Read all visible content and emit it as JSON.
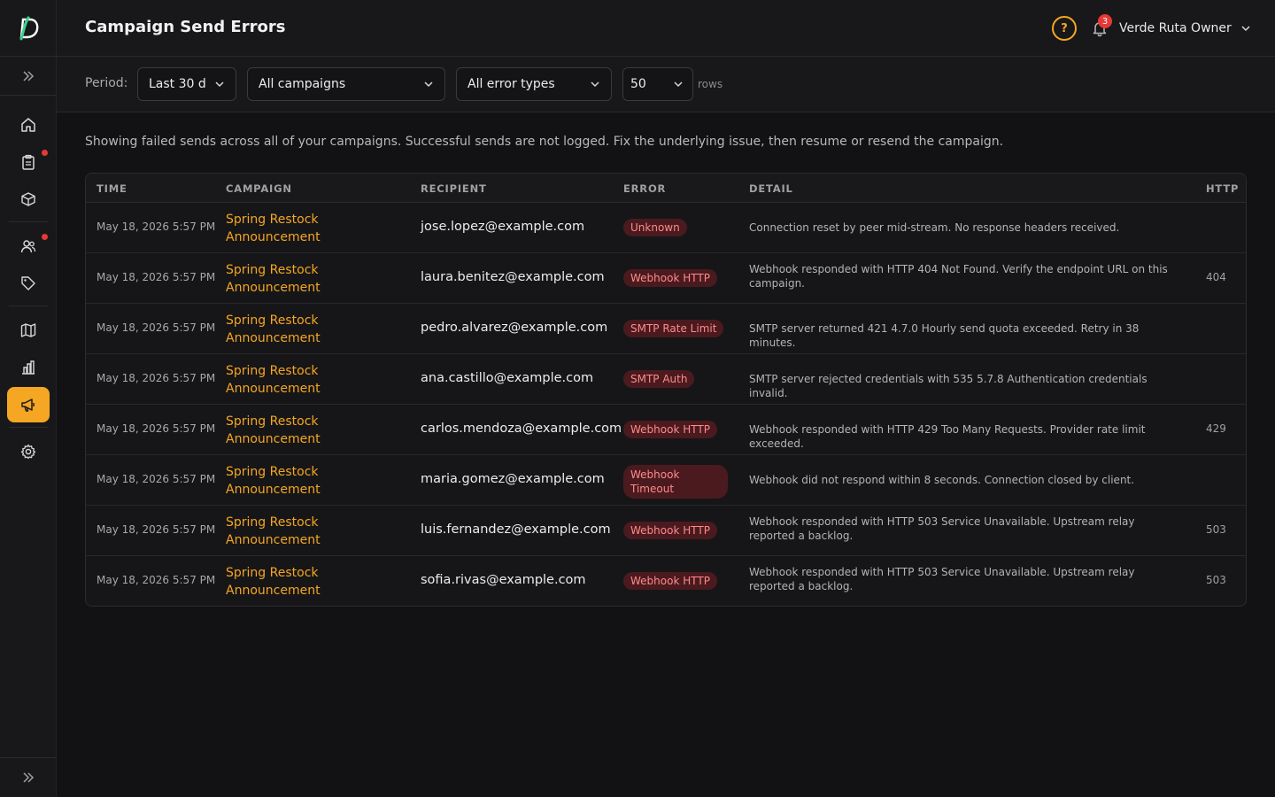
{
  "header": {
    "title": "Campaign Send Errors",
    "help_icon": "question-circle-icon",
    "notifications_count": "3",
    "user_name": "Verde Ruta Owner"
  },
  "filters": {
    "period_label": "Period:",
    "period_value": "Last 30 d",
    "campaign_value": "All campaigns",
    "error_type_value": "All error types",
    "rows_value": "50",
    "rows_label": "rows"
  },
  "description": "Showing failed sends across all of your campaigns. Successful sends are not logged. Fix the underlying issue, then resume or resend the campaign.",
  "table": {
    "columns": [
      "TIME",
      "CAMPAIGN",
      "RECIPIENT",
      "ERROR",
      "DETAIL",
      "HTTP"
    ],
    "rows": [
      {
        "time": "May 18, 2026 5:57 PM",
        "campaign_l1": "Spring Restock",
        "campaign_l2": "Announcement",
        "recipient": "jose.lopez@example.com",
        "error": "Unknown",
        "detail": "Connection reset by peer mid-stream. No response headers received.",
        "http": ""
      },
      {
        "time": "May 18, 2026 5:57 PM",
        "campaign_l1": "Spring Restock",
        "campaign_l2": "Announcement",
        "recipient": "laura.benitez@example.com",
        "error": "Webhook HTTP",
        "detail": "Webhook responded with HTTP 404 Not Found. Verify the endpoint URL on this campaign.",
        "http": "404"
      },
      {
        "time": "May 18, 2026 5:57 PM",
        "campaign_l1": "Spring Restock",
        "campaign_l2": "Announcement",
        "recipient": "pedro.alvarez@example.com",
        "error": "SMTP Rate Limit",
        "detail": "SMTP server returned 421 4.7.0 Hourly send quota exceeded. Retry in 38 minutes.",
        "http": ""
      },
      {
        "time": "May 18, 2026 5:57 PM",
        "campaign_l1": "Spring Restock",
        "campaign_l2": "Announcement",
        "recipient": "ana.castillo@example.com",
        "error": "SMTP Auth",
        "detail": "SMTP server rejected credentials with 535 5.7.8 Authentication credentials invalid.",
        "http": ""
      },
      {
        "time": "May 18, 2026 5:57 PM",
        "campaign_l1": "Spring Restock",
        "campaign_l2": "Announcement",
        "recipient": "carlos.mendoza@example.com",
        "error": "Webhook HTTP",
        "detail": "Webhook responded with HTTP 429 Too Many Requests. Provider rate limit exceeded.",
        "http": "429"
      },
      {
        "time": "May 18, 2026 5:57 PM",
        "campaign_l1": "Spring Restock",
        "campaign_l2": "Announcement",
        "recipient": "maria.gomez@example.com",
        "error": "Webhook Timeout",
        "detail": "Webhook did not respond within 8 seconds. Connection closed by client.",
        "http": ""
      },
      {
        "time": "May 18, 2026 5:57 PM",
        "campaign_l1": "Spring Restock",
        "campaign_l2": "Announcement",
        "recipient": "luis.fernandez@example.com",
        "error": "Webhook HTTP",
        "detail": "Webhook responded with HTTP 503 Service Unavailable. Upstream relay reported a backlog.",
        "http": "503"
      },
      {
        "time": "May 18, 2026 5:57 PM",
        "campaign_l1": "Spring Restock",
        "campaign_l2": "Announcement",
        "recipient": "sofia.rivas@example.com",
        "error": "Webhook HTTP",
        "detail": "Webhook responded with HTTP 503 Service Unavailable. Upstream relay reported a backlog.",
        "http": "503"
      }
    ]
  },
  "sidebar": {
    "items": [
      {
        "icon": "home-icon"
      },
      {
        "icon": "clipboard-icon"
      },
      {
        "icon": "box-icon"
      },
      {
        "icon": "users-icon"
      },
      {
        "icon": "tag-icon"
      },
      {
        "icon": "map-icon"
      },
      {
        "icon": "bar-chart-icon"
      },
      {
        "icon": "megaphone-icon"
      },
      {
        "icon": "gear-icon"
      }
    ]
  },
  "colors": {
    "accent": "#f5a623",
    "badge_bg": "#4a1a1f",
    "badge_text": "#ff8a8a",
    "alert": "#e53935"
  }
}
